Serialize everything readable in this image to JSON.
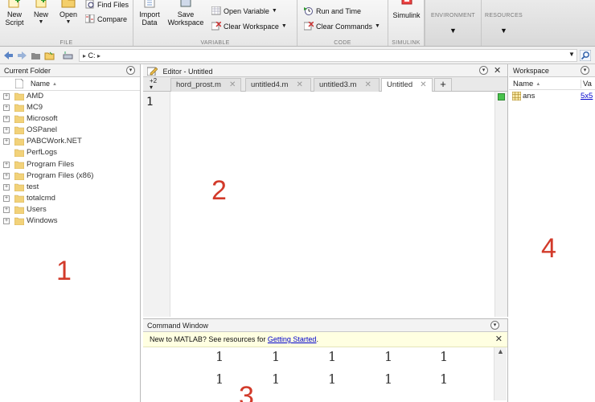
{
  "toolstrip": {
    "file": {
      "label": "FILE",
      "new_script": "New\nScript",
      "new": "New",
      "open": "Open",
      "find_files": "Find Files",
      "compare": "Compare"
    },
    "variable": {
      "label": "VARIABLE",
      "import_data": "Import\nData",
      "save_workspace": "Save\nWorkspace",
      "open_variable": "Open Variable",
      "clear_workspace": "Clear Workspace"
    },
    "code": {
      "label": "CODE",
      "run_and_time": "Run and Time",
      "clear_commands": "Clear Commands"
    },
    "simulink": {
      "label": "SIMULINK",
      "simulink": "Simulink"
    },
    "environment": "ENVIRONMENT",
    "resources": "RESOURCES"
  },
  "address": {
    "path": "C:",
    "sep": "▸"
  },
  "current_folder": {
    "title": "Current Folder",
    "column_name": "Name",
    "items": [
      "AMD",
      "MC9",
      "Microsoft",
      "OSPanel",
      "PABCWork.NET",
      "PerfLogs",
      "Program Files",
      "Program Files (x86)",
      "test",
      "totalcmd",
      "Users",
      "Windows"
    ],
    "expandable": [
      true,
      true,
      true,
      true,
      true,
      false,
      true,
      true,
      true,
      true,
      true,
      true
    ]
  },
  "editor": {
    "title": "Editor - Untitled",
    "tab_count": "+2",
    "tabs": [
      "hord_prost.m",
      "untitled4.m",
      "untitled3.m",
      "Untitled"
    ],
    "active_tab": "Untitled",
    "line_number": "1"
  },
  "command_window": {
    "title": "Command Window",
    "banner_text": "New to MATLAB? See resources for ",
    "banner_link": "Getting Started",
    "banner_end": ".",
    "output_rows": [
      [
        "1",
        "1",
        "1",
        "1",
        "1"
      ],
      [
        "1",
        "1",
        "1",
        "1",
        "1"
      ]
    ]
  },
  "workspace": {
    "title": "Workspace",
    "col_name": "Name",
    "col_value": "Va",
    "variables": [
      {
        "name": "ans",
        "value": "5x5"
      }
    ]
  },
  "annotations": [
    "1",
    "2",
    "3",
    "4"
  ],
  "colors": {
    "annotation": "#d23a2a",
    "link": "#0000cc",
    "folder_icon": "#f2d27a",
    "banner_bg": "#ffffe1"
  }
}
